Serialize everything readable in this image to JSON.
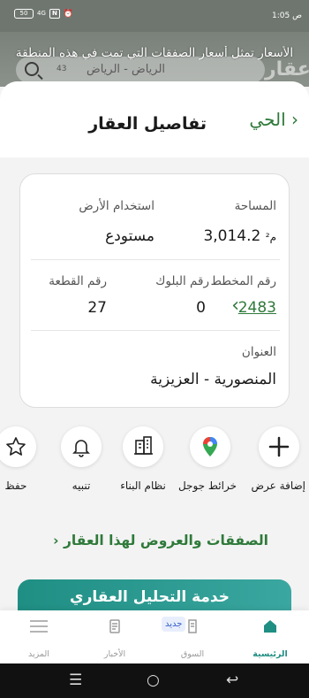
{
  "status_bar": {
    "time": "1:05 ص",
    "battery": "50",
    "signal": "4G",
    "icon_n": "N"
  },
  "map": {
    "note": "الأسعار تمثل أسعار الصفقات التي تمت في هذه المنطقة",
    "search_text": "الرياض - الرياض",
    "badge": "43",
    "logo": "عقار"
  },
  "sheet": {
    "title": "تفاصيل العقار",
    "back_label": "الحي"
  },
  "details": {
    "area_label": "المساحة",
    "area_value": "3,014.2",
    "area_unit": "م²",
    "land_use_label": "استخدام الأرض",
    "land_use_value": "مستودع",
    "plan_label": "رقم المخطط",
    "plan_value": "2483",
    "block_label": "رقم البلوك",
    "block_value": "0",
    "plot_label": "رقم القطعة",
    "plot_value": "27",
    "address_label": "العنوان",
    "address_value": "المنصورية - العزيزية"
  },
  "actions": [
    {
      "label": "إضافة عرض",
      "icon": "plus-icon"
    },
    {
      "label": "خرائط جوجل",
      "icon": "google-maps-pin-icon"
    },
    {
      "label": "نظام البناء",
      "icon": "building-icon"
    },
    {
      "label": "تنبيه",
      "icon": "bell-icon"
    },
    {
      "label": "حفظ",
      "icon": "star-icon"
    }
  ],
  "deals_link": "الصفقات والعروض لهذا العقار",
  "banner": {
    "text": "خدمة التحليل العقاري"
  },
  "bottom_nav": [
    {
      "label": "الرئيسية",
      "icon": "home-icon",
      "active": true
    },
    {
      "label": "السوق",
      "icon": "market-icon",
      "badge": "جديد"
    },
    {
      "label": "الأخبار",
      "icon": "news-icon"
    },
    {
      "label": "المزيد",
      "icon": "menu-icon"
    }
  ],
  "colors": {
    "accent": "#2f7a3a",
    "teal": "#1f8e83"
  }
}
